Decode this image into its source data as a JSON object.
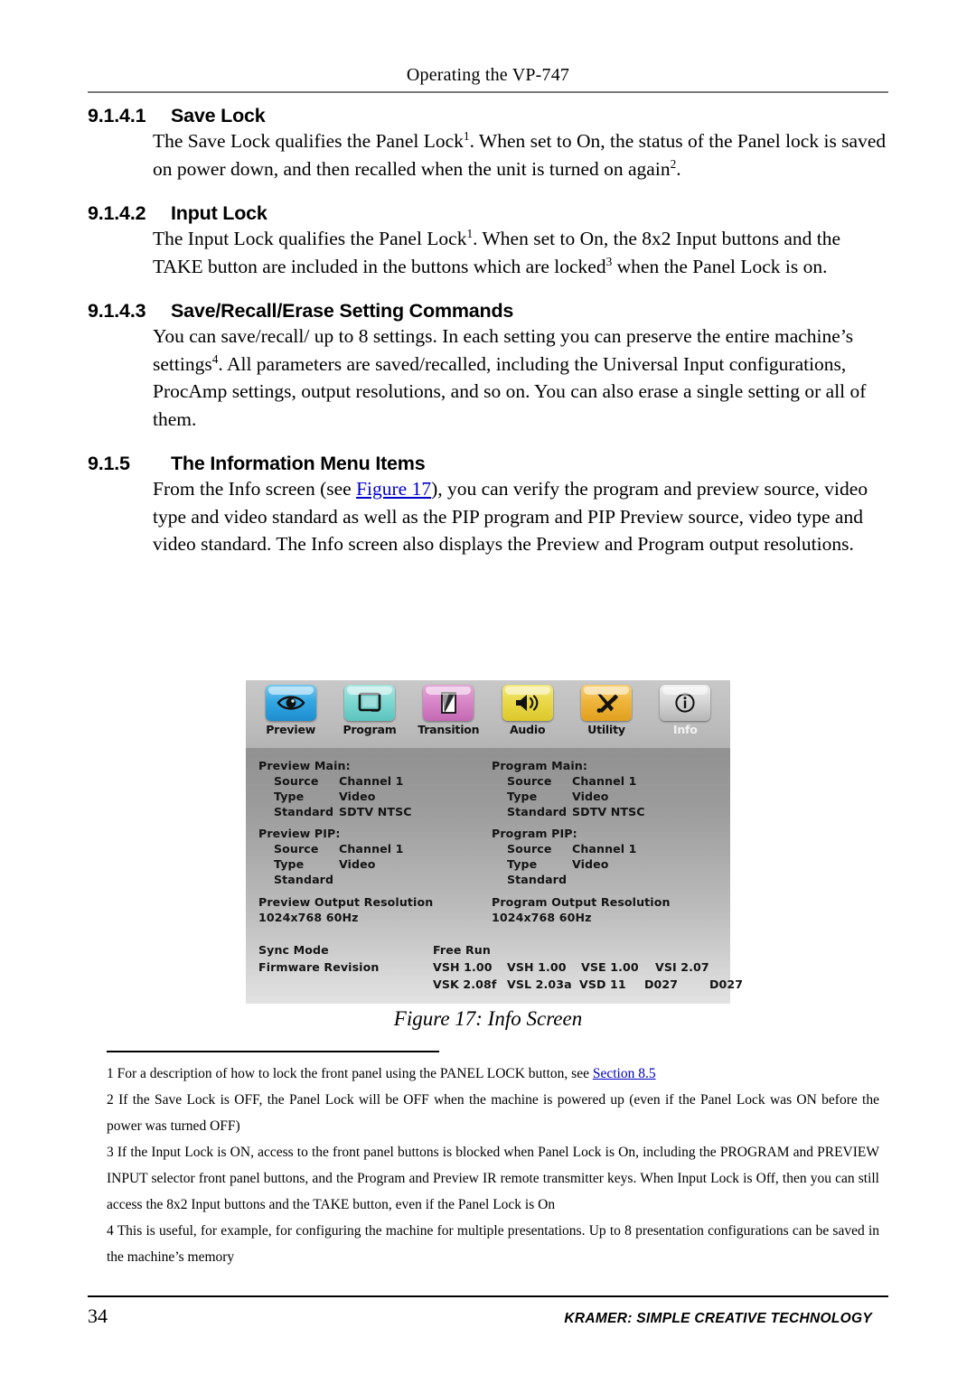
{
  "header": {
    "running_title": "Operating the VP-747"
  },
  "sections": [
    {
      "number": "9.1.4.1",
      "title": "Save Lock",
      "body_html": "The Save Lock qualifies the Panel Lock<sup>1</sup>. When set to On, the status of the Panel lock is saved on power down, and then recalled when the unit is turned on again<sup>2</sup>."
    },
    {
      "number": "9.1.4.2",
      "title": "Input Lock",
      "body_html": "The Input Lock qualifies the Panel Lock<sup>1</sup>. When set to On, the 8x2 Input buttons and the TAKE button are included in the buttons which are locked<sup>3</sup> when the Panel Lock is on."
    },
    {
      "number": "9.1.4.3",
      "title": "Save/Recall/Erase Setting Commands",
      "body_html": "You can save/recall/ up to 8 settings. In each setting you can preserve the entire machine’s settings<sup>4</sup>. All parameters are saved/recalled, including the Universal Input configurations, ProcAmp settings, output resolutions, and so on. You can also erase a single setting or all of them."
    },
    {
      "number": "9.1.5",
      "title": "The Information Menu Items",
      "body_html": "From the Info screen (see <a class=\"link\" href=\"#\" data-name=\"figure-17-link\" data-interactable=\"true\">Figure 17</a>), you can verify the program and preview source, video type and video standard as well as the PIP program and PIP Preview source, video type and video standard. The Info screen also displays the Preview and Program output resolutions."
    }
  ],
  "figure": {
    "caption": "Figure 17: Info Screen",
    "toolbar": [
      {
        "label": "Preview",
        "icon": "eye-icon",
        "color": "#35a8e4",
        "selected": false
      },
      {
        "label": "Program",
        "icon": "monitor-icon",
        "color": "#7fd8d2",
        "selected": false
      },
      {
        "label": "Transition",
        "icon": "page-peel-icon",
        "color": "#d887c8",
        "selected": false
      },
      {
        "label": "Audio",
        "icon": "speaker-icon",
        "color": "#ead94a",
        "selected": false
      },
      {
        "label": "Utility",
        "icon": "tools-icon",
        "color": "#efb63c",
        "selected": false
      },
      {
        "label": "Info",
        "icon": "info-icon",
        "color": "#d6d6d6",
        "selected": true
      }
    ],
    "preview_main": {
      "title": "Preview Main:",
      "source_label": "Source",
      "source_value": "Channel 1",
      "type_label": "Type",
      "type_value": "Video",
      "standard_label": "Standard",
      "standard_value": "SDTV NTSC"
    },
    "preview_pip": {
      "title": "Preview PIP:",
      "source_label": "Source",
      "source_value": "Channel 1",
      "type_label": "Type",
      "type_value": "Video",
      "standard_label": "Standard",
      "standard_value": ""
    },
    "program_main": {
      "title": "Program Main:",
      "source_label": "Source",
      "source_value": "Channel 1",
      "type_label": "Type",
      "type_value": "Video",
      "standard_label": "Standard",
      "standard_value": "SDTV NTSC"
    },
    "program_pip": {
      "title": "Program PIP:",
      "source_label": "Source",
      "source_value": "Channel 1",
      "type_label": "Type",
      "type_value": "Video",
      "standard_label": "Standard",
      "standard_value": ""
    },
    "preview_output": {
      "title": "Preview Output Resolution",
      "value": "1024x768 60Hz"
    },
    "program_output": {
      "title": "Program Output Resolution",
      "value": "1024x768 60Hz"
    },
    "sync_mode": {
      "label": "Sync Mode",
      "value": "Free Run"
    },
    "firmware": {
      "label": "Firmware Revision",
      "line1": [
        "VSH 1.00",
        "VSH 1.00",
        "VSE 1.00",
        "VSI 2.07"
      ],
      "line2": [
        "VSK 2.08f",
        "VSL 2.03a",
        "VSD 11",
        "D027",
        "D027"
      ]
    }
  },
  "footnotes": [
    {
      "html": "1 For a description of how to lock the front panel using the PANEL LOCK button, see <a class=\"link\" href=\"#\" data-name=\"section-8-5-link\" data-interactable=\"true\">Section 8.5</a>"
    },
    {
      "html": "2 If the Save Lock is OFF, the Panel Lock will be OFF when the machine is powered up (even if the Panel Lock was ON before the power was turned OFF)"
    },
    {
      "html": "3 If the Input Lock is ON, access to the front panel buttons is blocked when Panel Lock is On, including the PROGRAM and PREVIEW INPUT selector front panel buttons, and the Program and Preview IR remote transmitter keys. When Input Lock is Off, then you can still access the 8x2 Input buttons and the TAKE button, even if the Panel Lock is On"
    },
    {
      "html": "4 This is useful, for example, for configuring the machine for multiple presentations. Up to 8 presentation configurations can be saved in the machine’s memory"
    }
  ],
  "footer": {
    "page_number": "34",
    "brand": "KRAMER: SIMPLE CREATIVE TECHNOLOGY"
  }
}
